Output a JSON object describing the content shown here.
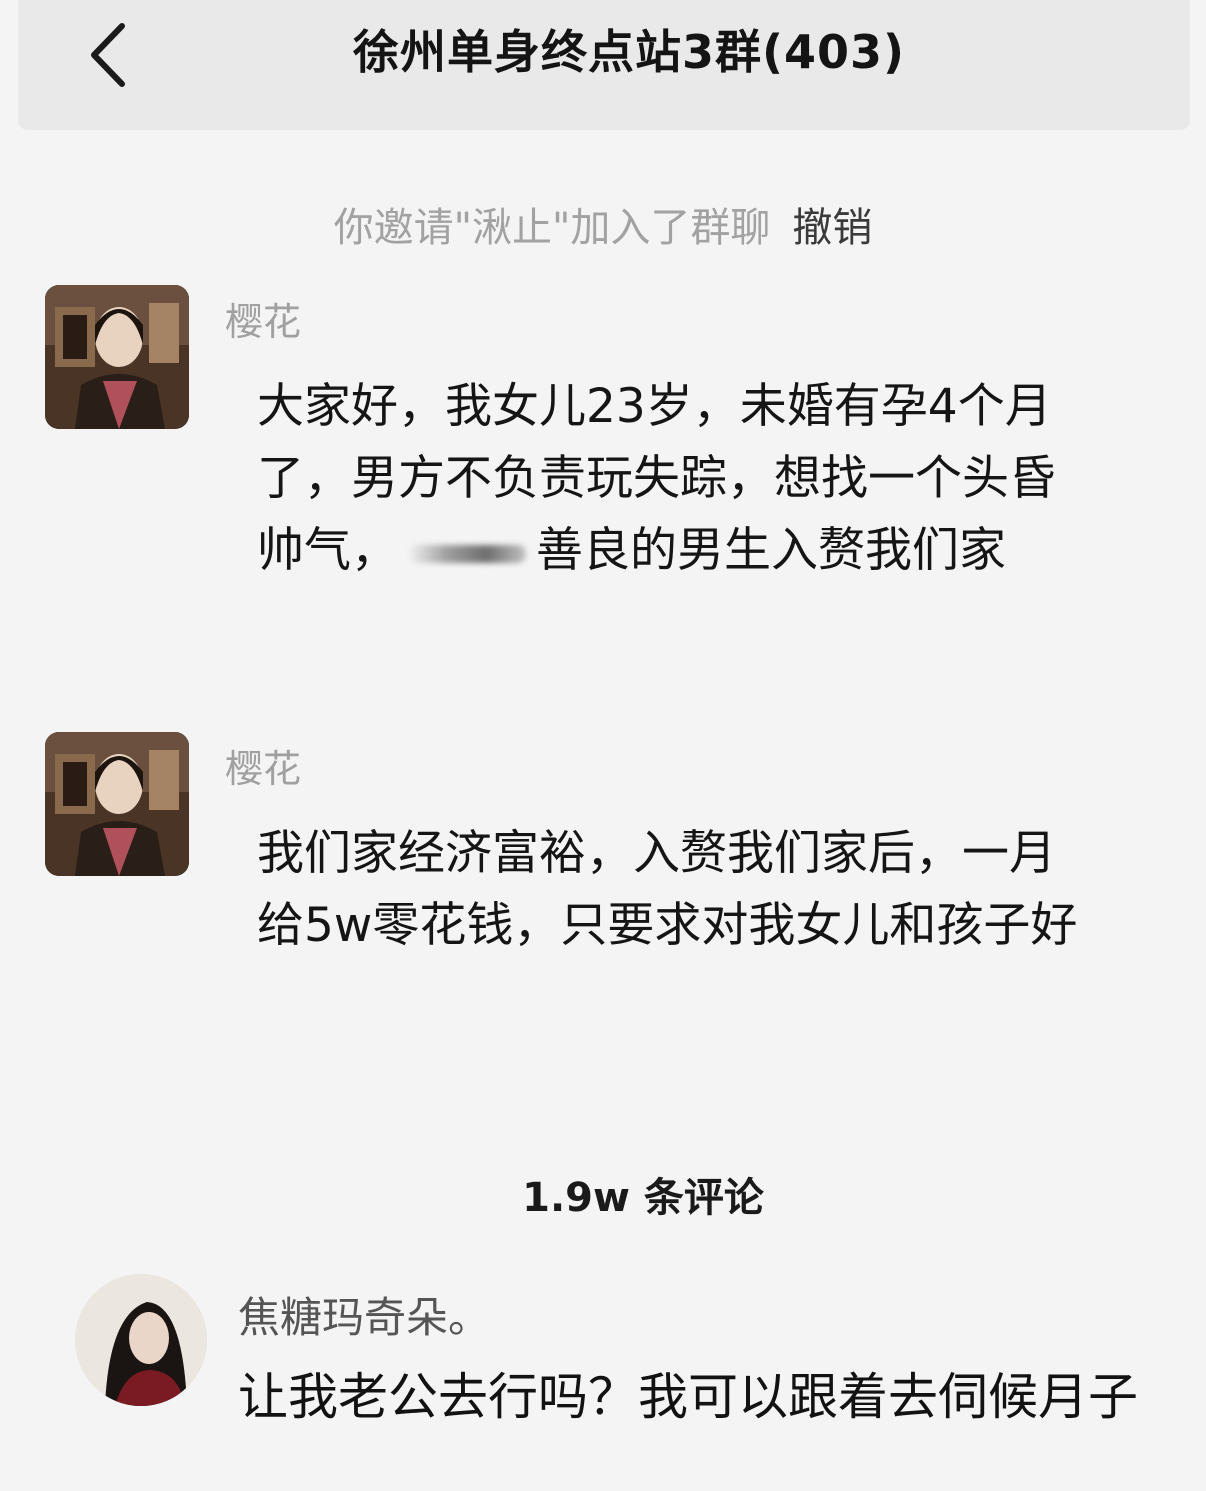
{
  "header": {
    "title": "徐州单身终点站3群(403)",
    "back_icon": "chevron-left-icon"
  },
  "system_notice": {
    "text": "你邀请\"湫止\"加入了群聊",
    "action": "撤销"
  },
  "messages": [
    {
      "sender": "樱花",
      "text_before": "大家好，我女儿23岁，未婚有孕4个月了，男方不负责玩失踪，想找一个头昏帅气，",
      "text_after": "善良的男生入赘我们家"
    },
    {
      "sender": "樱花",
      "text": "我们家经济富裕，入赘我们家后，一月给5w零花钱，只要求对我女儿和孩子好"
    }
  ],
  "comments_section": {
    "count_label": "1.9w 条评论"
  },
  "comment": {
    "user": "焦糖玛奇朵。",
    "text": "让我老公去行吗？我可以跟着去伺候月子"
  },
  "colors": {
    "page_background": "#f4f4f4",
    "header_background": "#e9e9e9",
    "muted_text": "#a0a0a0",
    "primary_text": "#151515"
  }
}
